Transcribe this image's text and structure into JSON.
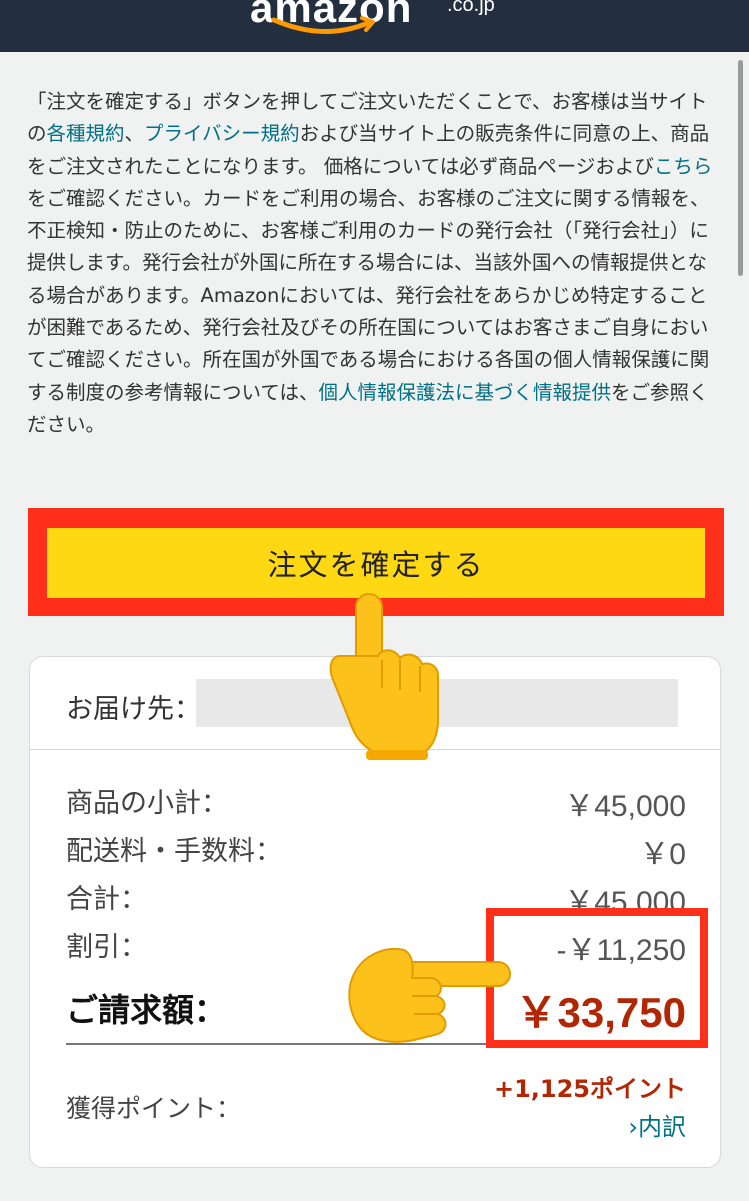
{
  "header": {
    "logo": "amazon",
    "tld": ".co.jp"
  },
  "notice": {
    "p1": "「注文を確定する」ボタンを押してご注文いただくことで、お客様は当サイトの",
    "link_terms": "各種規約",
    "sep1": "、",
    "link_privacy": "プライバシー規約",
    "p2": "および当サイト上の販売条件に同意の上、商品をご注文されたことになります。 価格については必ず商品ページおよび",
    "link_here": "こちら",
    "p3": "をご確認ください。カードをご利用の場合、お客様のご注文に関する情報を、不正検知・防止のために、お客様ご利用のカードの発行会社（「発行会社」）に提供します。発行会社が外国に所在する場合には、当該外国への情報提供となる場合があります。Amazonにおいては、発行会社をあらかじめ特定することが困難であるため、発行会社及びその所在国についてはお客さまご自身においてご確認ください。所在国が外国である場合における各国の個人情報保護に関する制度の参考情報については、",
    "link_info": "個人情報保護法に基づく情報提供",
    "p4": "をご参照ください。"
  },
  "confirm_button": "注文を確定する",
  "summary": {
    "delivery_label": "お届け先：",
    "rows": [
      {
        "label": "商品の小計：",
        "value": "￥45,000"
      },
      {
        "label": "配送料・手数料：",
        "value": "￥0"
      },
      {
        "label": "合計：",
        "value": "￥45,000"
      },
      {
        "label": "割引：",
        "value": "-￥11,250"
      }
    ],
    "total_label": "ご請求額：",
    "total_value": "￥33,750",
    "points_label": "獲得ポイント：",
    "points_value": "+1,125ポイント",
    "breakdown_link": "内訳"
  },
  "colors": {
    "accent_red": "#ff2f1a",
    "button_yellow": "#ffd814",
    "price_red": "#b12704",
    "link_teal": "#007185"
  },
  "icons": [
    "pointing-up-hand-icon",
    "pointing-right-hand-icon",
    "chevron-right-icon"
  ]
}
